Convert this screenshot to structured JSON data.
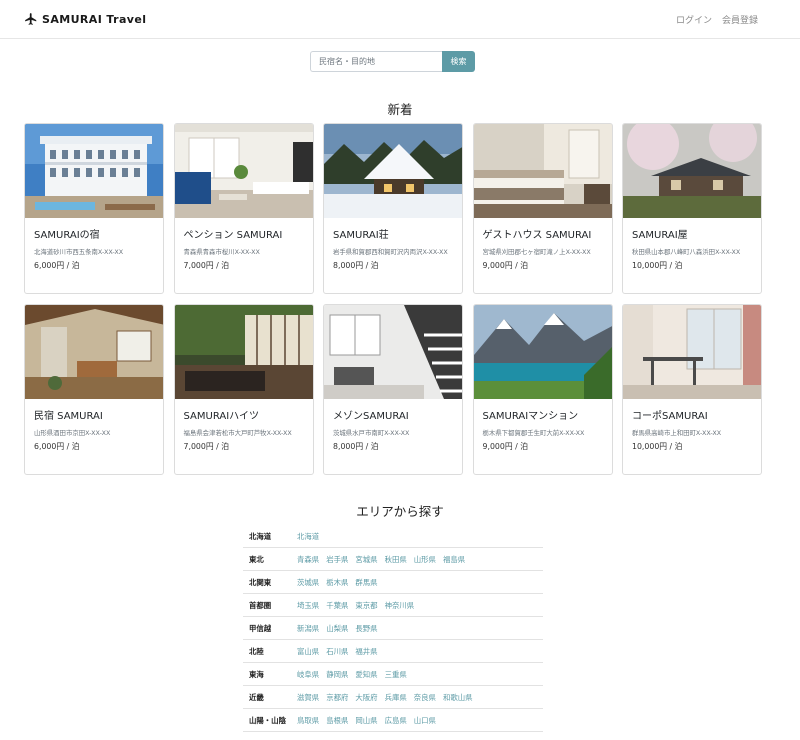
{
  "header": {
    "logo_text": "SAMURAI Travel",
    "nav": [
      "ログイン",
      "会員登録"
    ]
  },
  "search": {
    "placeholder": "民宿名・目的地",
    "button_label": "検索"
  },
  "new_section": {
    "title": "新着",
    "cards": [
      {
        "name": "SAMURAIの宿",
        "address": "北海道砂川市西五条南X-XX-XX",
        "price": "6,000円 / 泊",
        "image": "hotel-photo"
      },
      {
        "name": "ペンション SAMURAI",
        "address": "青森県青森市桜川X-XX-XX",
        "price": "7,000円 / 泊",
        "image": "living-room-photo"
      },
      {
        "name": "SAMURAI荘",
        "address": "岩手県和賀郡西和賀町沢内両沢X-XX-XX",
        "price": "8,000円 / 泊",
        "image": "snow-house-photo"
      },
      {
        "name": "ゲストハウス SAMURAI",
        "address": "宮城県刈田郡七ヶ宿町滝ノ上X-XX-XX",
        "price": "9,000円 / 泊",
        "image": "bedroom-photo"
      },
      {
        "name": "SAMURAI屋",
        "address": "秋田県山本郡八峰町八森浜田X-XX-XX",
        "price": "10,000円 / 泊",
        "image": "japanese-house-photo"
      },
      {
        "name": "民宿 SAMURAI",
        "address": "山形県酒田市京田X-XX-XX",
        "price": "6,000円 / 泊",
        "image": "lodge-interior-photo"
      },
      {
        "name": "SAMURAIハイツ",
        "address": "福島県会津若松市大戸町芦牧X-XX-XX",
        "price": "7,000円 / 泊",
        "image": "ryokan-photo"
      },
      {
        "name": "メゾンSAMURAI",
        "address": "茨城県水戸市南町X-XX-XX",
        "price": "8,000円 / 泊",
        "image": "staircase-photo"
      },
      {
        "name": "SAMURAIマンション",
        "address": "栃木県下都賀郡壬生町大前X-XX-XX",
        "price": "9,000円 / 泊",
        "image": "lake-mountain-photo"
      },
      {
        "name": "コーポSAMURAI",
        "address": "群馬県高崎市上和田町X-XX-XX",
        "price": "10,000円 / 泊",
        "image": "dining-room-photo"
      }
    ]
  },
  "area_section": {
    "title": "エリアから探す",
    "rows": [
      {
        "region": "北海道",
        "prefectures": [
          "北海道"
        ]
      },
      {
        "region": "東北",
        "prefectures": [
          "青森県",
          "岩手県",
          "宮城県",
          "秋田県",
          "山形県",
          "福島県"
        ]
      },
      {
        "region": "北関東",
        "prefectures": [
          "茨城県",
          "栃木県",
          "群馬県"
        ]
      },
      {
        "region": "首都圏",
        "prefectures": [
          "埼玉県",
          "千葉県",
          "東京都",
          "神奈川県"
        ]
      },
      {
        "region": "甲信越",
        "prefectures": [
          "新潟県",
          "山梨県",
          "長野県"
        ]
      },
      {
        "region": "北陸",
        "prefectures": [
          "富山県",
          "石川県",
          "福井県"
        ]
      },
      {
        "region": "東海",
        "prefectures": [
          "岐阜県",
          "静岡県",
          "愛知県",
          "三重県"
        ]
      },
      {
        "region": "近畿",
        "prefectures": [
          "滋賀県",
          "京都府",
          "大阪府",
          "兵庫県",
          "奈良県",
          "和歌山県"
        ]
      },
      {
        "region": "山陽・山陰",
        "prefectures": [
          "鳥取県",
          "島根県",
          "岡山県",
          "広島県",
          "山口県"
        ]
      }
    ]
  },
  "colors": {
    "accent": "#5d9ba6",
    "border": "#dcdcdc"
  }
}
